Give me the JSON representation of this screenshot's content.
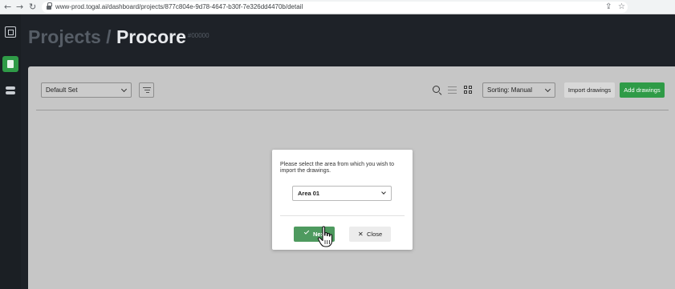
{
  "browser": {
    "back": "←",
    "forward": "→",
    "reload": "↻",
    "url": "www-prod.togal.ai/dashboard/projects/877c804e-9d78-4647-b30f-7e326dd4470b/detail",
    "share": "⇪",
    "star": "☆"
  },
  "header": {
    "breadcrumb": "Projects",
    "separator": "/",
    "project": "Procore",
    "code": "#00000"
  },
  "toolbar": {
    "set_select": "Default Set",
    "sorting_select": "Sorting: Manual",
    "import_label": "Import drawings",
    "add_label": "Add drawings"
  },
  "modal": {
    "message": "Please select the area from which you wish to import the drawings.",
    "area_select": "Area 01",
    "next_label": "Next",
    "close_label": "Close"
  },
  "colors": {
    "brand_green": "#2f9b47",
    "dark_bg": "#1e2228"
  },
  "icons": {
    "logo": "crop-frame-icon",
    "nav_active": "document-icon",
    "nav_tools": "toggles-icon",
    "filter": "filter-icon",
    "search": "search-icon",
    "list": "list-view-icon",
    "grid": "grid-view-icon",
    "check": "check-icon",
    "close": "close-icon",
    "cursor": "hand-pointer-icon"
  }
}
